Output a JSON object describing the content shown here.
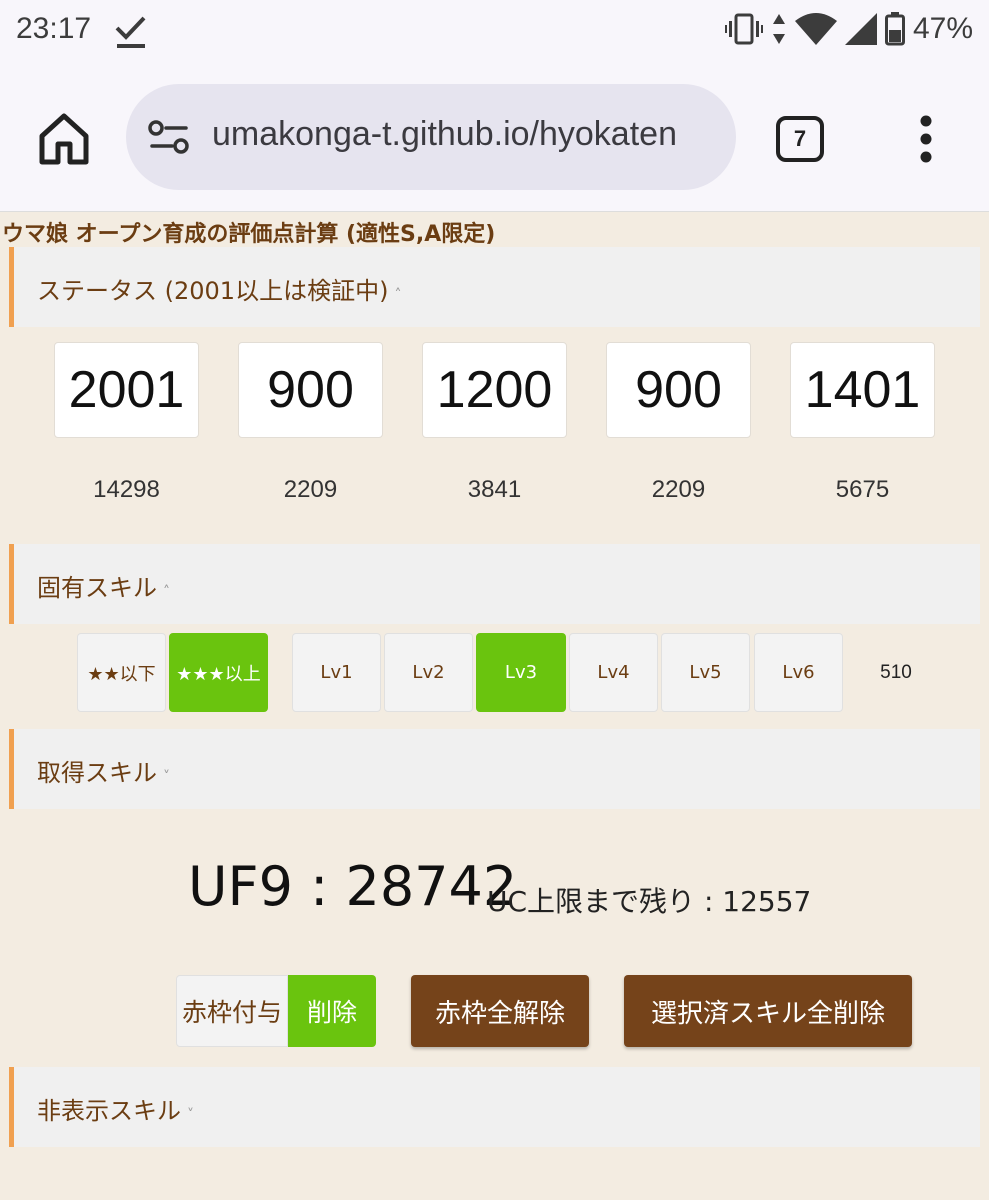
{
  "status_bar": {
    "time": "23:17",
    "battery": "47%",
    "icons": [
      "download-done-icon",
      "vibrate-icon",
      "data-arrows-icon",
      "wifi-icon",
      "signal-icon",
      "battery-icon"
    ]
  },
  "browser": {
    "url": "umakonga-t.github.io/hyokaten",
    "tab_count": "7",
    "icons": [
      "home-icon",
      "site-settings-icon",
      "more-vert-icon"
    ]
  },
  "page": {
    "title": "ウマ娘 オープン育成の評価点計算 (適性S,A限定)",
    "sections": {
      "status": "ステータス (2001以上は検証中)",
      "unique_skill": "固有スキル",
      "acquired_skill": "取得スキル",
      "hidden_skill": "非表示スキル"
    },
    "stats": [
      {
        "value": "2001",
        "score": "14298"
      },
      {
        "value": "900",
        "score": "2209"
      },
      {
        "value": "1200",
        "score": "3841"
      },
      {
        "value": "900",
        "score": "2209"
      },
      {
        "value": "1401",
        "score": "5675"
      }
    ],
    "unique_skill": {
      "stars": [
        {
          "label": "★★以下",
          "active": false
        },
        {
          "label": "★★★以上",
          "active": true
        }
      ],
      "levels": [
        {
          "label": "Lv1",
          "active": false
        },
        {
          "label": "Lv2",
          "active": false
        },
        {
          "label": "Lv3",
          "active": true
        },
        {
          "label": "Lv4",
          "active": false
        },
        {
          "label": "Lv5",
          "active": false
        },
        {
          "label": "Lv6",
          "active": false
        }
      ],
      "score": "510"
    },
    "rank": {
      "main": "UF9 : 28742",
      "sub": "UC上限まで残り : 12557"
    },
    "actions": {
      "toggle_off": "赤枠付与",
      "toggle_on": "削除",
      "clear_red": "赤枠全解除",
      "delete_all": "選択済スキル全削除"
    },
    "colors": {
      "background": "#f3ece1",
      "brown": "#75431a",
      "green": "#6ac40e",
      "accent_orange": "#f0a050"
    }
  }
}
